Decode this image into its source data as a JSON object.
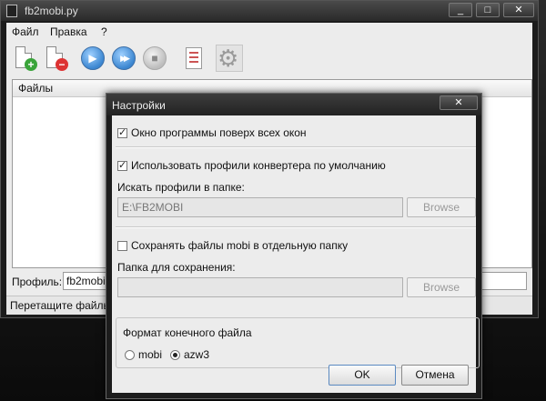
{
  "main_window": {
    "title": "fb2mobi.py",
    "controls": {
      "minimize": "_",
      "maximize": "□",
      "close": "✕"
    }
  },
  "menu": [
    "Файл",
    "Правка",
    "?"
  ],
  "toolbar": {
    "icons": [
      "add-file-icon",
      "remove-file-icon",
      "play-icon",
      "fast-forward-icon",
      "stop-icon",
      "log-report-icon",
      "gear-icon"
    ],
    "play_glyph": "▶",
    "fast_forward_glyph": "▶▶",
    "stop_glyph": "■",
    "gear_glyph": "⚙",
    "add_badge": "+",
    "remove_badge": "−"
  },
  "files_panel": {
    "header": "Файлы"
  },
  "profile": {
    "label": "Профиль:",
    "value": "fb2mobi"
  },
  "status": {
    "text": "Перетащите файлы"
  },
  "settings_dialog": {
    "title": "Настройки",
    "close_glyph": "✕",
    "always_on_top": {
      "label": "Окно программы поверх всех окон",
      "checked": true
    },
    "use_default_profiles": {
      "label": "Использовать профили конвертера по умолчанию",
      "checked": true
    },
    "profiles_folder": {
      "label": "Искать профили в папке:",
      "value": "E:\\FB2MOBI",
      "browse": "Browse"
    },
    "save_separate": {
      "label": "Сохранять файлы mobi в отдельную папку",
      "checked": false
    },
    "save_folder": {
      "label": "Папка для сохранения:",
      "value": "",
      "browse": "Browse"
    },
    "output_format": {
      "label": "Формат конечного файла",
      "options": [
        "mobi",
        "azw3"
      ],
      "selected": "azw3"
    },
    "ok": "OK",
    "cancel": "Отмена",
    "check_glyph": "✓"
  }
}
